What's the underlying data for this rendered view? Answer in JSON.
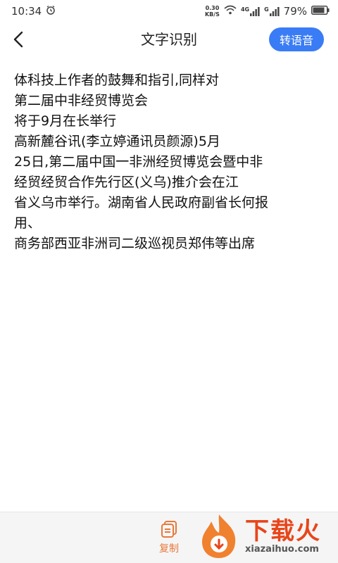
{
  "status_bar": {
    "time": "10:34",
    "speed_value": "0.30",
    "speed_unit": "KB/S",
    "network_4g": "4G",
    "network_g": "G",
    "battery": "79%"
  },
  "nav": {
    "title": "文字识别",
    "tts_label": "转语音"
  },
  "content": {
    "lines": [
      "体科技上作者的鼓舞和指引,同样对",
      "第二届中非经贸博览会",
      "将于9月在长举行",
      "高新麓谷讯(李立婷通讯员颜源)5月",
      "25日,第二届中国一非洲经贸博览会暨中非",
      "经贸经贸合作先行区(义乌)推介会在江",
      "省义乌市举行。湖南省人民政府副省长何报",
      "用、",
      "商务部西亚非洲司二级巡视员郑伟等出席"
    ]
  },
  "bottom": {
    "copy_label": "复制"
  },
  "watermark": {
    "brand": "下载火",
    "domain": "xiazaihuo.com"
  },
  "colors": {
    "accent_blue": "#3a7cf5",
    "copy_orange": "#e8793a",
    "brand_red": "#e8451a"
  }
}
